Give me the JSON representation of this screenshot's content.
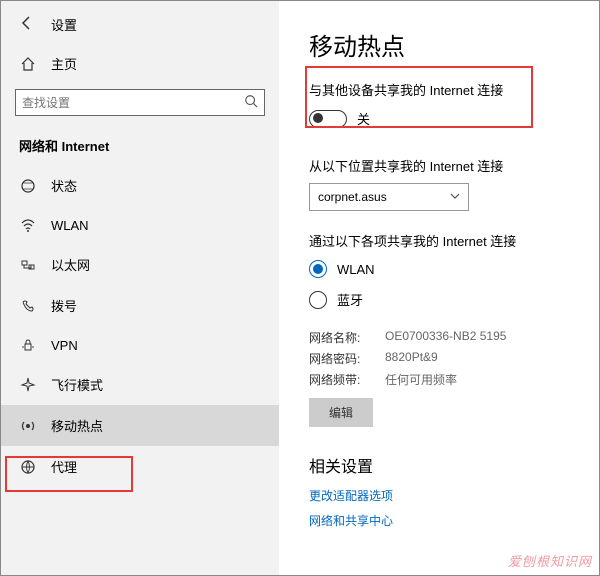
{
  "header": {
    "title": "设置"
  },
  "home": {
    "label": "主页"
  },
  "search": {
    "placeholder": "查找设置"
  },
  "section_title": "网络和 Internet",
  "nav": [
    {
      "key": "status",
      "label": "状态"
    },
    {
      "key": "wlan",
      "label": "WLAN"
    },
    {
      "key": "ethernet",
      "label": "以太网"
    },
    {
      "key": "dialup",
      "label": "拨号"
    },
    {
      "key": "vpn",
      "label": "VPN"
    },
    {
      "key": "airplane",
      "label": "飞行模式"
    },
    {
      "key": "hotspot",
      "label": "移动热点"
    },
    {
      "key": "proxy",
      "label": "代理"
    }
  ],
  "page": {
    "title": "移动热点",
    "share": {
      "label": "与其他设备共享我的 Internet 连接",
      "state": "关",
      "on": false
    },
    "from": {
      "label": "从以下位置共享我的 Internet 连接",
      "value": "corpnet.asus"
    },
    "via": {
      "label": "通过以下各项共享我的 Internet 连接",
      "options": [
        {
          "label": "WLAN",
          "checked": true
        },
        {
          "label": "蓝牙",
          "checked": false
        }
      ]
    },
    "info": {
      "name_key": "网络名称:",
      "name_val": "OE0700336-NB2 5195",
      "pass_key": "网络密码:",
      "pass_val": "8820Pt&9",
      "band_key": "网络频带:",
      "band_val": "任何可用频率"
    },
    "edit_btn": "编辑",
    "related": {
      "title": "相关设置",
      "links": [
        "更改适配器选项",
        "网络和共享中心"
      ]
    }
  },
  "watermark": "爱刨根知识网"
}
